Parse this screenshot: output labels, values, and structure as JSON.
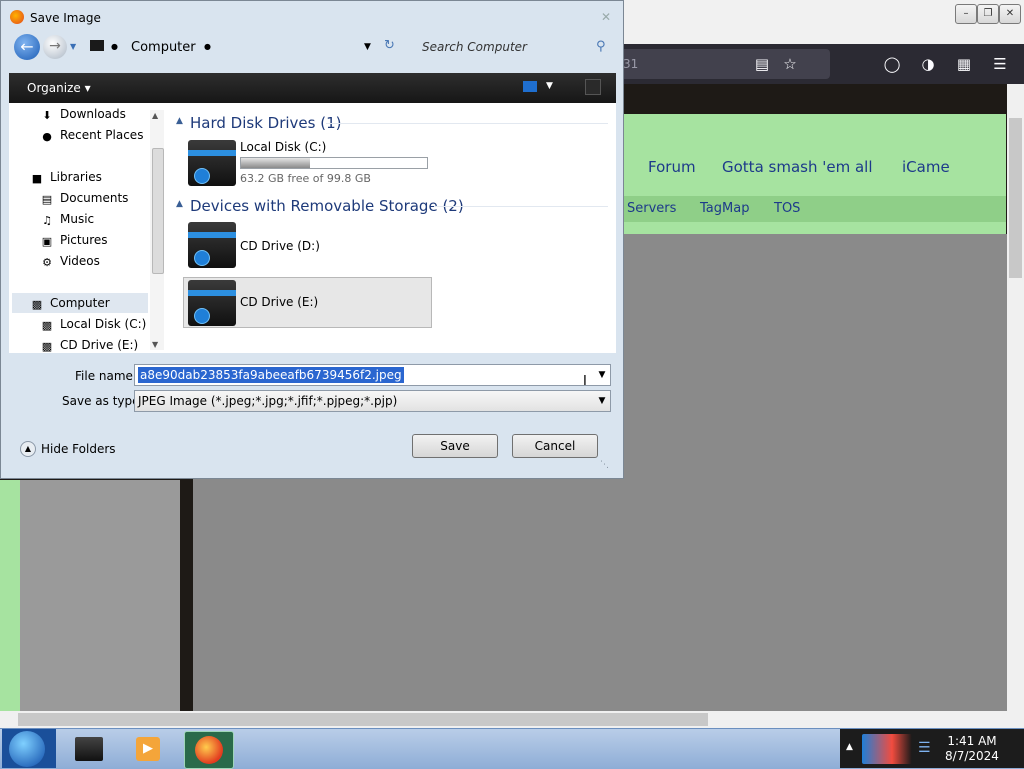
{
  "browser": {
    "url_fragment": "31",
    "nav_primary": [
      "Forum",
      "Gotta smash 'em all",
      "iCame"
    ],
    "nav_secondary": [
      "Servers",
      "TagMap",
      "TOS"
    ]
  },
  "dialog": {
    "title": "Save Image",
    "address": "Computer",
    "search_placeholder": "Search Computer",
    "organize_label": "Organize",
    "tree": [
      {
        "label": "Downloads",
        "icon": "download-folder-icon"
      },
      {
        "label": "Recent Places",
        "icon": "recent-places-icon"
      },
      {
        "label": "Libraries",
        "icon": "libraries-icon"
      },
      {
        "label": "Documents",
        "icon": "documents-icon"
      },
      {
        "label": "Music",
        "icon": "music-icon"
      },
      {
        "label": "Pictures",
        "icon": "pictures-icon"
      },
      {
        "label": "Videos",
        "icon": "videos-icon"
      },
      {
        "label": "Computer",
        "icon": "computer-icon"
      },
      {
        "label": "Local Disk (C:)",
        "icon": "disk-icon"
      },
      {
        "label": "CD Drive (E:)",
        "icon": "cd-drive-icon"
      }
    ],
    "groups": {
      "hard_disks": "Hard Disk Drives (1)",
      "removable": "Devices with Removable Storage (2)"
    },
    "drives": {
      "c": {
        "name": "Local Disk (C:)",
        "free_text": "63.2 GB free of 99.8 GB",
        "used_fraction": 0.37
      },
      "d": {
        "name": "CD Drive (D:)"
      },
      "e": {
        "name": "CD Drive (E:)"
      }
    },
    "file_name_label": "File name:",
    "file_name_value": "a8e90dab23853fa9abeeafb6739456f2.jpeg",
    "save_type_label": "Save as type:",
    "save_type_value": "JPEG Image (*.jpeg;*.jpg;*.jfif;*.pjpeg;*.pjp)",
    "save_button": "Save",
    "cancel_button": "Cancel",
    "hide_folders": "Hide Folders"
  },
  "taskbar": {
    "time": "1:41 AM",
    "date": "8/7/2024"
  }
}
